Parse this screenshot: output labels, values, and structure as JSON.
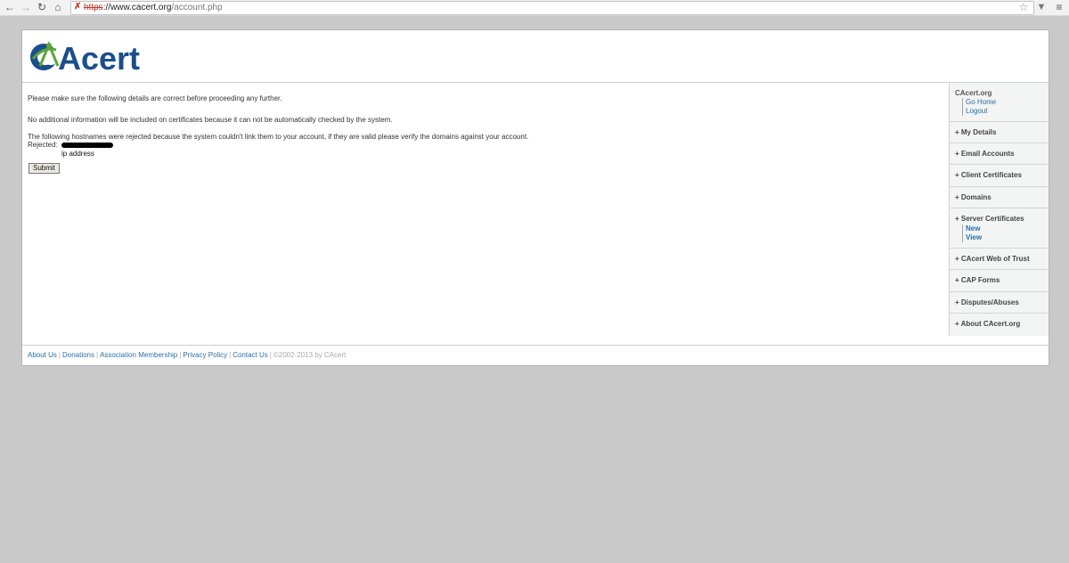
{
  "browser": {
    "url_scheme": "https",
    "url_host": "://www.cacert.org",
    "url_path": "/account.php"
  },
  "brand": {
    "logo_text": "CAcert",
    "accent": "#1a4f8c",
    "logo_green": "#5aa63b"
  },
  "main": {
    "intro": "Please make sure the following details are correct before proceeding any further.",
    "no_info": "No additional information will be included on certificates because it can not be automatically checked by the system.",
    "rejected_note": "The following hostnames were rejected because the system couldn't link them to your account, if they are valid please verify the domains against your account.",
    "rejected_label": "Rejected:",
    "ip_text": "ip address",
    "submit_label": "Submit"
  },
  "sidebar": {
    "title": "CAcert.org",
    "home_link": "Go Home",
    "logout_link": "Logout",
    "items": [
      {
        "label": "+ My Details"
      },
      {
        "label": "+ Email Accounts"
      },
      {
        "label": "+ Client Certificates"
      },
      {
        "label": "+ Domains"
      },
      {
        "label": "+ Server Certificates"
      },
      {
        "label": "+ CAcert Web of Trust"
      },
      {
        "label": "+ CAP Forms"
      },
      {
        "label": "+ Disputes/Abuses"
      },
      {
        "label": "+ About CAcert.org"
      }
    ],
    "server_new": "New",
    "server_view": "View"
  },
  "footer": {
    "about": "About Us",
    "donations": "Donations",
    "association": "Association Membership",
    "privacy": "Privacy Policy",
    "contact": "Contact Us",
    "copyright": "©2002-2013 by CAcert"
  }
}
